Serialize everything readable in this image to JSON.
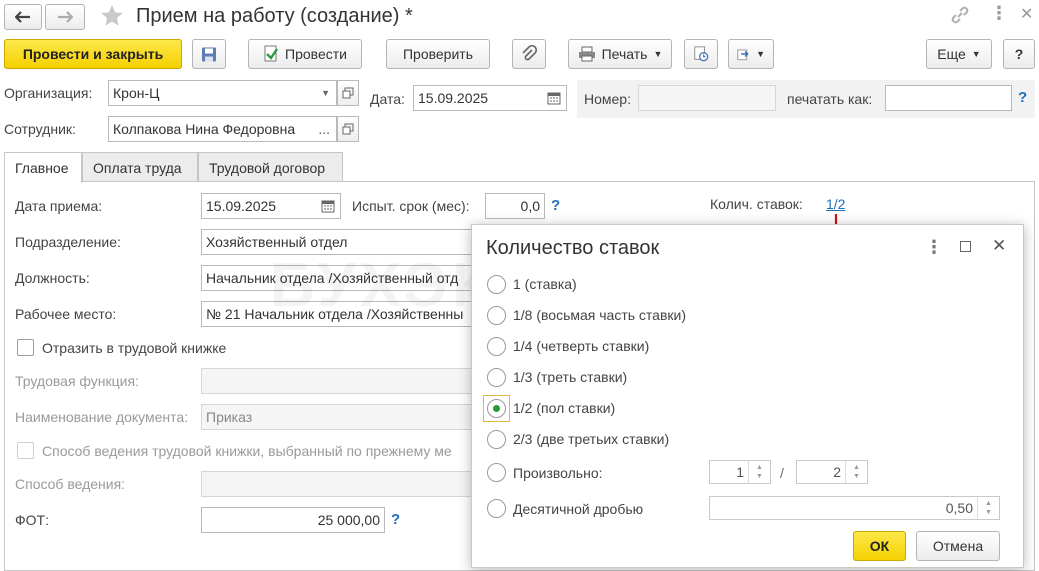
{
  "window": {
    "title": "Прием на работу (создание) *"
  },
  "toolbar": {
    "post_close": "Провести и закрыть",
    "post": "Провести",
    "check": "Проверить",
    "print": "Печать",
    "more": "Еще",
    "help": "?"
  },
  "header": {
    "org_label": "Организация:",
    "org_value": "Крон-Ц",
    "date_label": "Дата:",
    "date_value": "15.09.2025",
    "number_label": "Номер:",
    "number_value": "",
    "print_as_label": "печатать как:",
    "print_as_value": "",
    "employee_label": "Сотрудник:",
    "employee_value": "Колпакова Нина Федоровна",
    "ellipsis": "...",
    "help": "?"
  },
  "tabs": [
    {
      "label": "Главное",
      "active": true
    },
    {
      "label": "Оплата труда",
      "active": false
    },
    {
      "label": "Трудовой договор",
      "active": false
    }
  ],
  "main": {
    "hire_date_label": "Дата приема:",
    "hire_date_value": "15.09.2025",
    "trial_label": "Испыт. срок (мес):",
    "trial_value": "0,0",
    "trial_help": "?",
    "rates_label": "Колич. ставок:",
    "rates_value": "1/2",
    "dept_label": "Подразделение:",
    "dept_value": "Хозяйственный отдел",
    "position_label": "Должность:",
    "position_value": "Начальник отдела /Хозяйственный отд",
    "workplace_label": "Рабочее место:",
    "workplace_value": "№ 21 Начальник отдела /Хозяйственны",
    "workbook_check": "Отразить в трудовой книжке",
    "labor_function_label": "Трудовая функция:",
    "labor_function_value": "",
    "doc_name_label": "Наименование документа:",
    "doc_name_value": "Приказ",
    "method_prev_check": "Способ ведения трудовой книжки, выбранный по прежнему ме",
    "method_label": "Способ ведения:",
    "method_value": "",
    "fot_label": "ФОТ:",
    "fot_value": "25 000,00",
    "fot_help": "?"
  },
  "watermark": "БУХЭКСПЕРТ",
  "dialog": {
    "title": "Количество ставок",
    "options": [
      {
        "label": "1 (ставка)",
        "selected": false
      },
      {
        "label": "1/8 (восьмая часть ставки)",
        "selected": false
      },
      {
        "label": "1/4 (четверть ставки)",
        "selected": false
      },
      {
        "label": "1/3 (треть ставки)",
        "selected": false
      },
      {
        "label": "1/2 (пол ставки)",
        "selected": true
      },
      {
        "label": "2/3 (две третьих ставки)",
        "selected": false
      },
      {
        "label": "Произвольно:",
        "selected": false
      },
      {
        "label": "Десятичной дробью",
        "selected": false
      }
    ],
    "numerator": "1",
    "slash": "/",
    "denominator": "2",
    "decimal": "0,50",
    "ok": "ОК",
    "cancel": "Отмена"
  },
  "colors": {
    "primary_button": "#f5d000",
    "link": "#1e6fb8",
    "arrow": "#d01010",
    "radio_selected": "#2a9a3c"
  }
}
